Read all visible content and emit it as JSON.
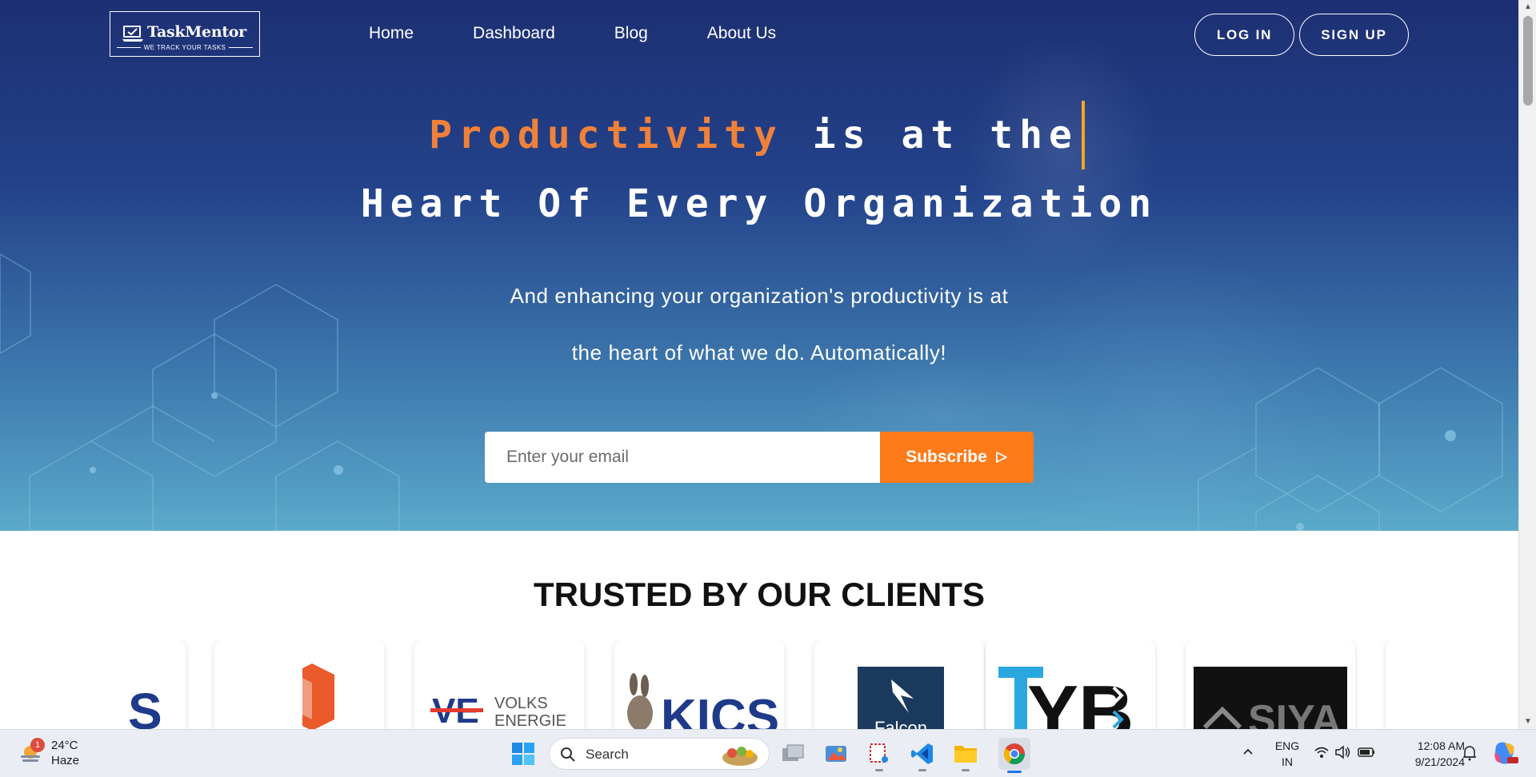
{
  "brand": {
    "name": "TaskMentor",
    "tagline": "WE TRACK YOUR TASKS"
  },
  "nav": {
    "items": [
      "Home",
      "Dashboard",
      "Blog",
      "About Us"
    ]
  },
  "auth": {
    "login": "LOG IN",
    "signup": "SIGN UP"
  },
  "hero": {
    "headline_accent": "Productivity",
    "headline_rest": "is at the",
    "headline_line2": "Heart Of Every Organization",
    "sub_line1": "And enhancing your organization's productivity is at",
    "sub_line2": "the heart of what we do. Automatically!",
    "email_placeholder": "Enter your email",
    "subscribe_label": "Subscribe",
    "accent_color": "#f0813a",
    "button_color": "#ff7a18"
  },
  "clients": {
    "title": "TRUSTED BY OUR CLIENTS",
    "logos": [
      "VOLKS ENERGIE",
      "KICS",
      "Falcon",
      "TYB",
      "SIYA"
    ]
  },
  "taskbar": {
    "weather_temp": "24°C",
    "weather_cond": "Haze",
    "weather_badge": "1",
    "search_label": "Search",
    "lang_line1": "ENG",
    "lang_line2": "IN",
    "time": "12:08 AM",
    "date": "9/21/2024",
    "apps": [
      "task-view",
      "photos",
      "snipping-tool",
      "vscode",
      "file-explorer",
      "chrome"
    ]
  }
}
